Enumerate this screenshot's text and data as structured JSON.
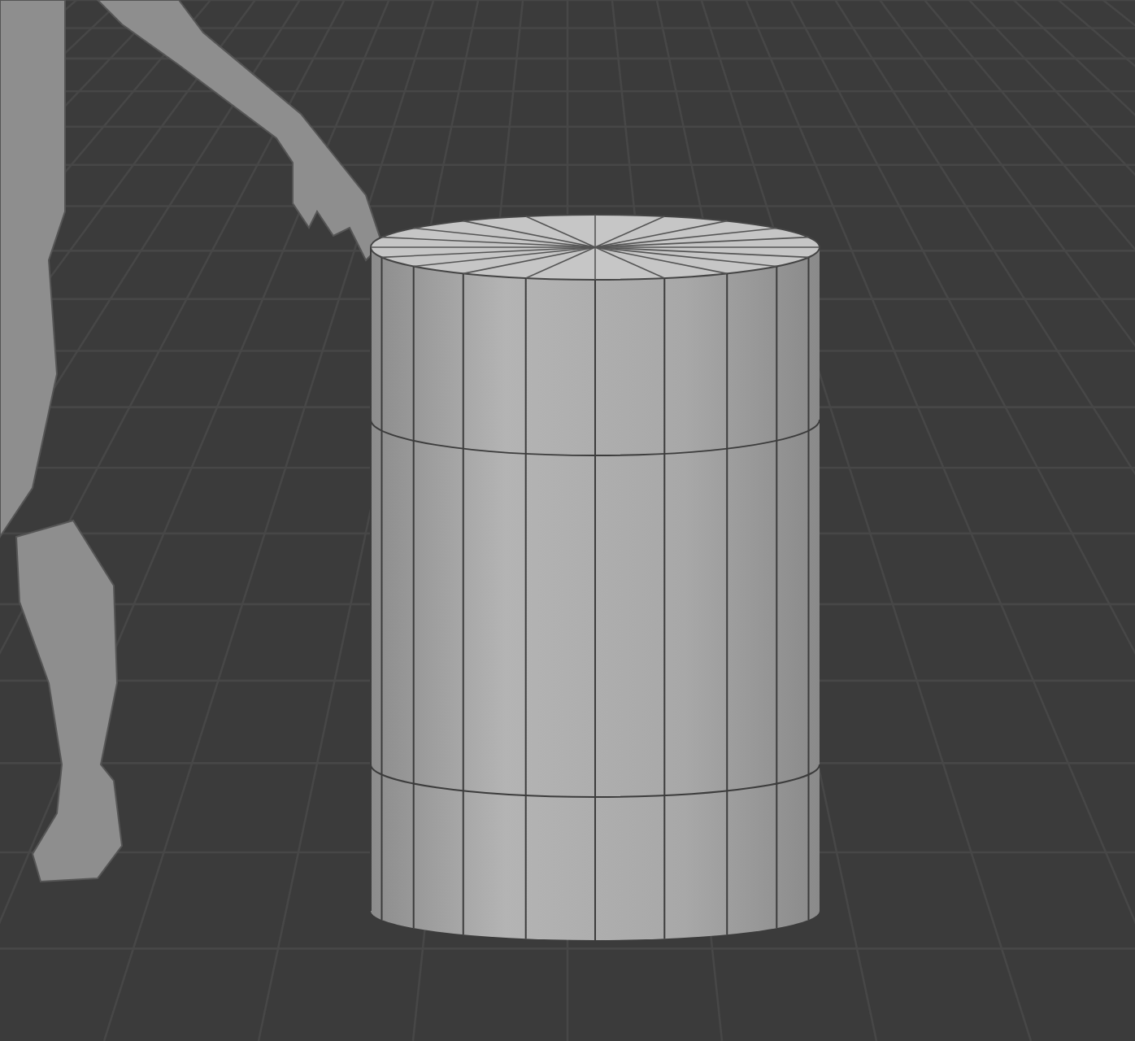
{
  "viewport": {
    "objects": [
      {
        "kind": "floor-grid"
      },
      {
        "kind": "mannequin"
      },
      {
        "kind": "cylinder"
      }
    ]
  }
}
